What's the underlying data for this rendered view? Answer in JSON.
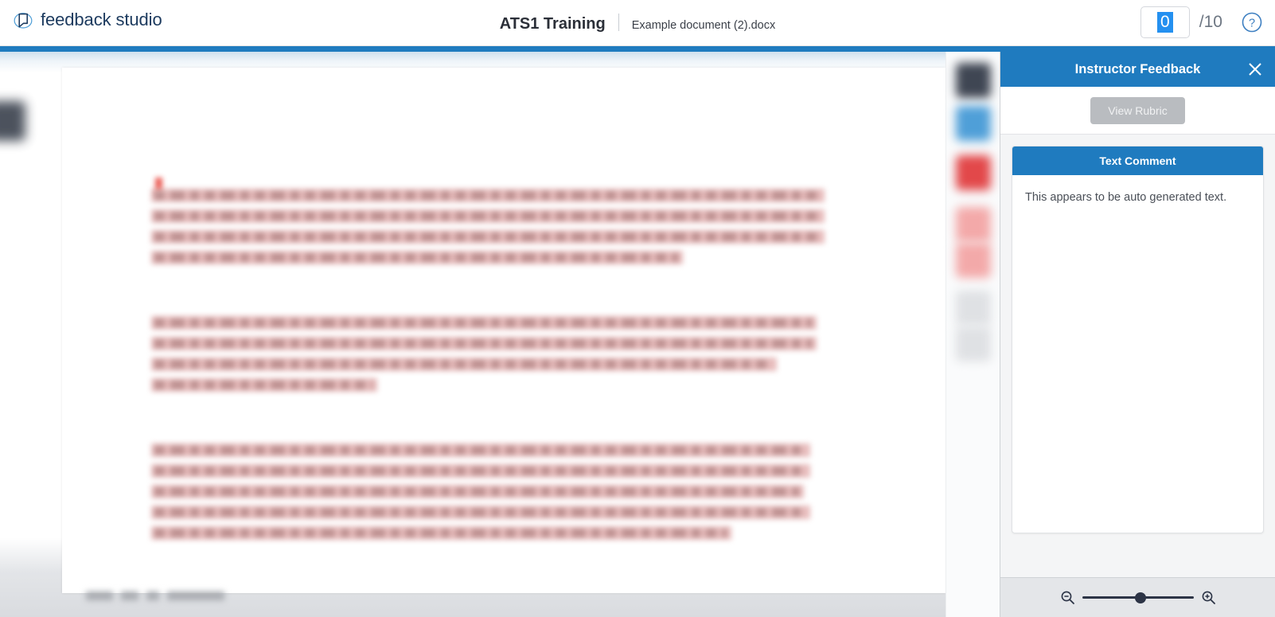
{
  "app": {
    "brand_name": "feedback studio",
    "brand_icon": "feedback-studio-logo-icon"
  },
  "header": {
    "assignment_title": "ATS1 Training",
    "paper_name": "Example document (2).docx",
    "grade": {
      "value": "0",
      "total": "/10"
    },
    "help_icon": "help-circle-icon"
  },
  "viewer": {
    "page_footer_present": true,
    "scrollbar_present": true,
    "tool_rail": {
      "tools": [
        {
          "name": "instructor-avatar",
          "icon": "avatar-icon"
        },
        {
          "name": "quickmarks-panel",
          "icon": "comment-bubble-icon"
        },
        {
          "name": "similarity-panel",
          "icon": "similarity-icon"
        },
        {
          "name": "pink-tool-1",
          "icon": "match-overview-icon"
        },
        {
          "name": "pink-tool-2",
          "icon": "all-sources-icon"
        },
        {
          "name": "grey-tool-1",
          "icon": "filters-icon"
        },
        {
          "name": "grey-tool-2",
          "icon": "download-icon"
        }
      ]
    }
  },
  "feedback_panel": {
    "title": "Instructor Feedback",
    "close_icon": "close-icon",
    "view_rubric_label": "View Rubric",
    "comment_card": {
      "header": "Text Comment",
      "body": "This appears to be auto generated text."
    },
    "zoom": {
      "zoom_out_icon": "magnifier-minus-icon",
      "zoom_in_icon": "magnifier-plus-icon",
      "slider_position_percent": 48
    }
  },
  "colors": {
    "brand_blue": "#1f7bbf",
    "accent_selection": "#2490f0",
    "panel_bg": "#f4f5f6",
    "disabled_button": "#b9bcc0",
    "highlight_pink": "#e8bdbd"
  }
}
